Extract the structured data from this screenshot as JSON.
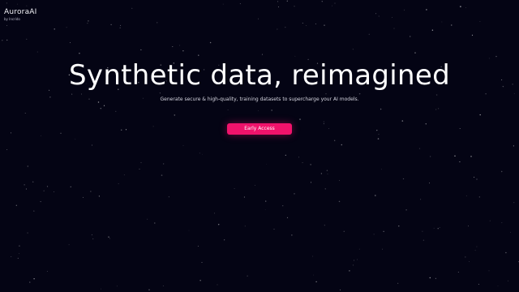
{
  "brand": {
    "name": "AuroraAI",
    "byline": "by Incrido"
  },
  "hero": {
    "title": "Synthetic data, reimagined",
    "subtitle": "Generate secure & high-quality, training datasets to supercharge your AI models."
  },
  "cta": {
    "label": "Early Access"
  },
  "colors": {
    "background": "#040414",
    "accent": "#f0136b",
    "text": "#ffffff"
  }
}
